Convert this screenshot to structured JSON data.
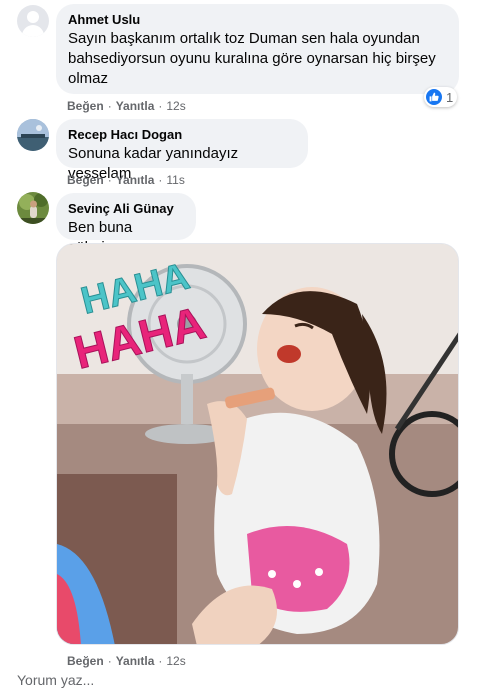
{
  "comments": [
    {
      "author": "Ahmet Uslu",
      "lines": [
        "Sayın başkanım ortalık toz Duman sen hala oyundan",
        "bahsediyorsun oyunu kuralına göre oynarsan hiç birşey",
        "olmaz"
      ],
      "like_label": "Beğen",
      "reply_label": "Yanıtla",
      "time": "12s",
      "reaction_count": "1"
    },
    {
      "author": "Recep Hacı Dogan",
      "lines": [
        "Sonuna kadar yanındayız vesselam"
      ],
      "like_label": "Beğen",
      "reply_label": "Yanıtla",
      "time": "11s"
    },
    {
      "author": "Sevinç Ali Günay",
      "lines": [
        "Ben buna gülerim"
      ],
      "like_label": "Beğen",
      "reply_label": "Yanıtla",
      "time": "12s",
      "gif_caption": "HAHA"
    }
  ],
  "separator": "·",
  "write_comment_placeholder": "Yorum yaz...",
  "colors": {
    "bubble": "#f0f2f5",
    "secondary_text": "#65676b",
    "like_blue": "#1877f2",
    "haha_teal": "#4cc4c8",
    "haha_pink": "#e8247a"
  }
}
